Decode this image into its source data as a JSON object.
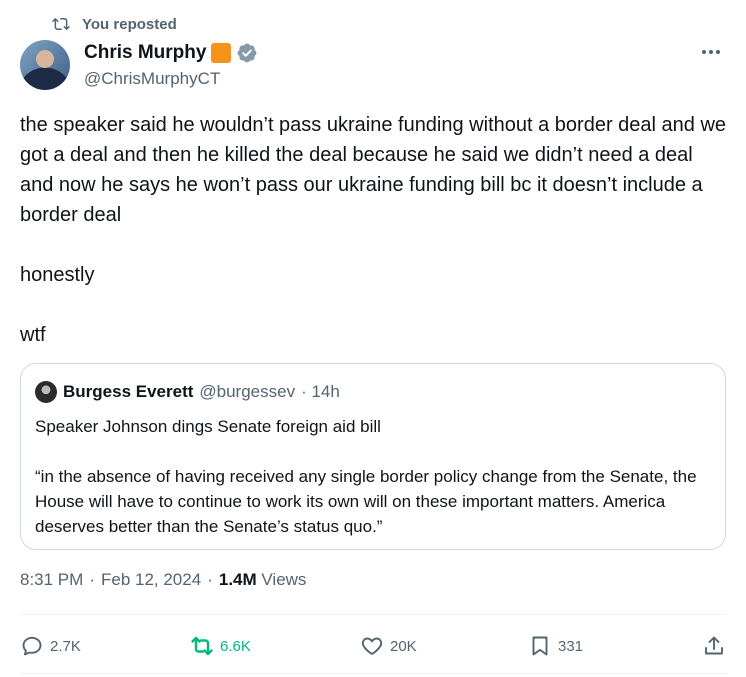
{
  "repost": {
    "label": "You reposted",
    "icon": "repost-icon"
  },
  "author": {
    "name": "Chris Murphy",
    "handle": "@ChrisMurphyCT",
    "badge_color": "#f7931a",
    "verified_icon": "verified-badge-icon"
  },
  "tweet": {
    "text": "the speaker said he wouldn’t pass ukraine funding without a border deal and we got a deal and then he killed the deal because he said we didn’t need a deal and now he says he won’t pass our ukraine funding bill bc it doesn’t include a border deal\n\nhonestly\n\nwtf"
  },
  "quote": {
    "name": "Burgess Everett",
    "handle": "@burgessev",
    "time": "· 14h",
    "text": "Speaker Johnson dings Senate foreign aid bill\n\n“in the absence of having received any single border policy change from the Senate, the House will have to continue to work its own will on these important matters. America deserves better than the Senate’s status quo.”"
  },
  "meta": {
    "time": "8:31 PM",
    "sep1": "·",
    "date": "Feb 12, 2024",
    "sep2": "·",
    "views_count": "1.4M",
    "views_label": "Views"
  },
  "actions": {
    "replies": "2.7K",
    "reposts": "6.6K",
    "likes": "20K",
    "bookmarks": "331",
    "repost_active_color": "#00ba7c"
  }
}
